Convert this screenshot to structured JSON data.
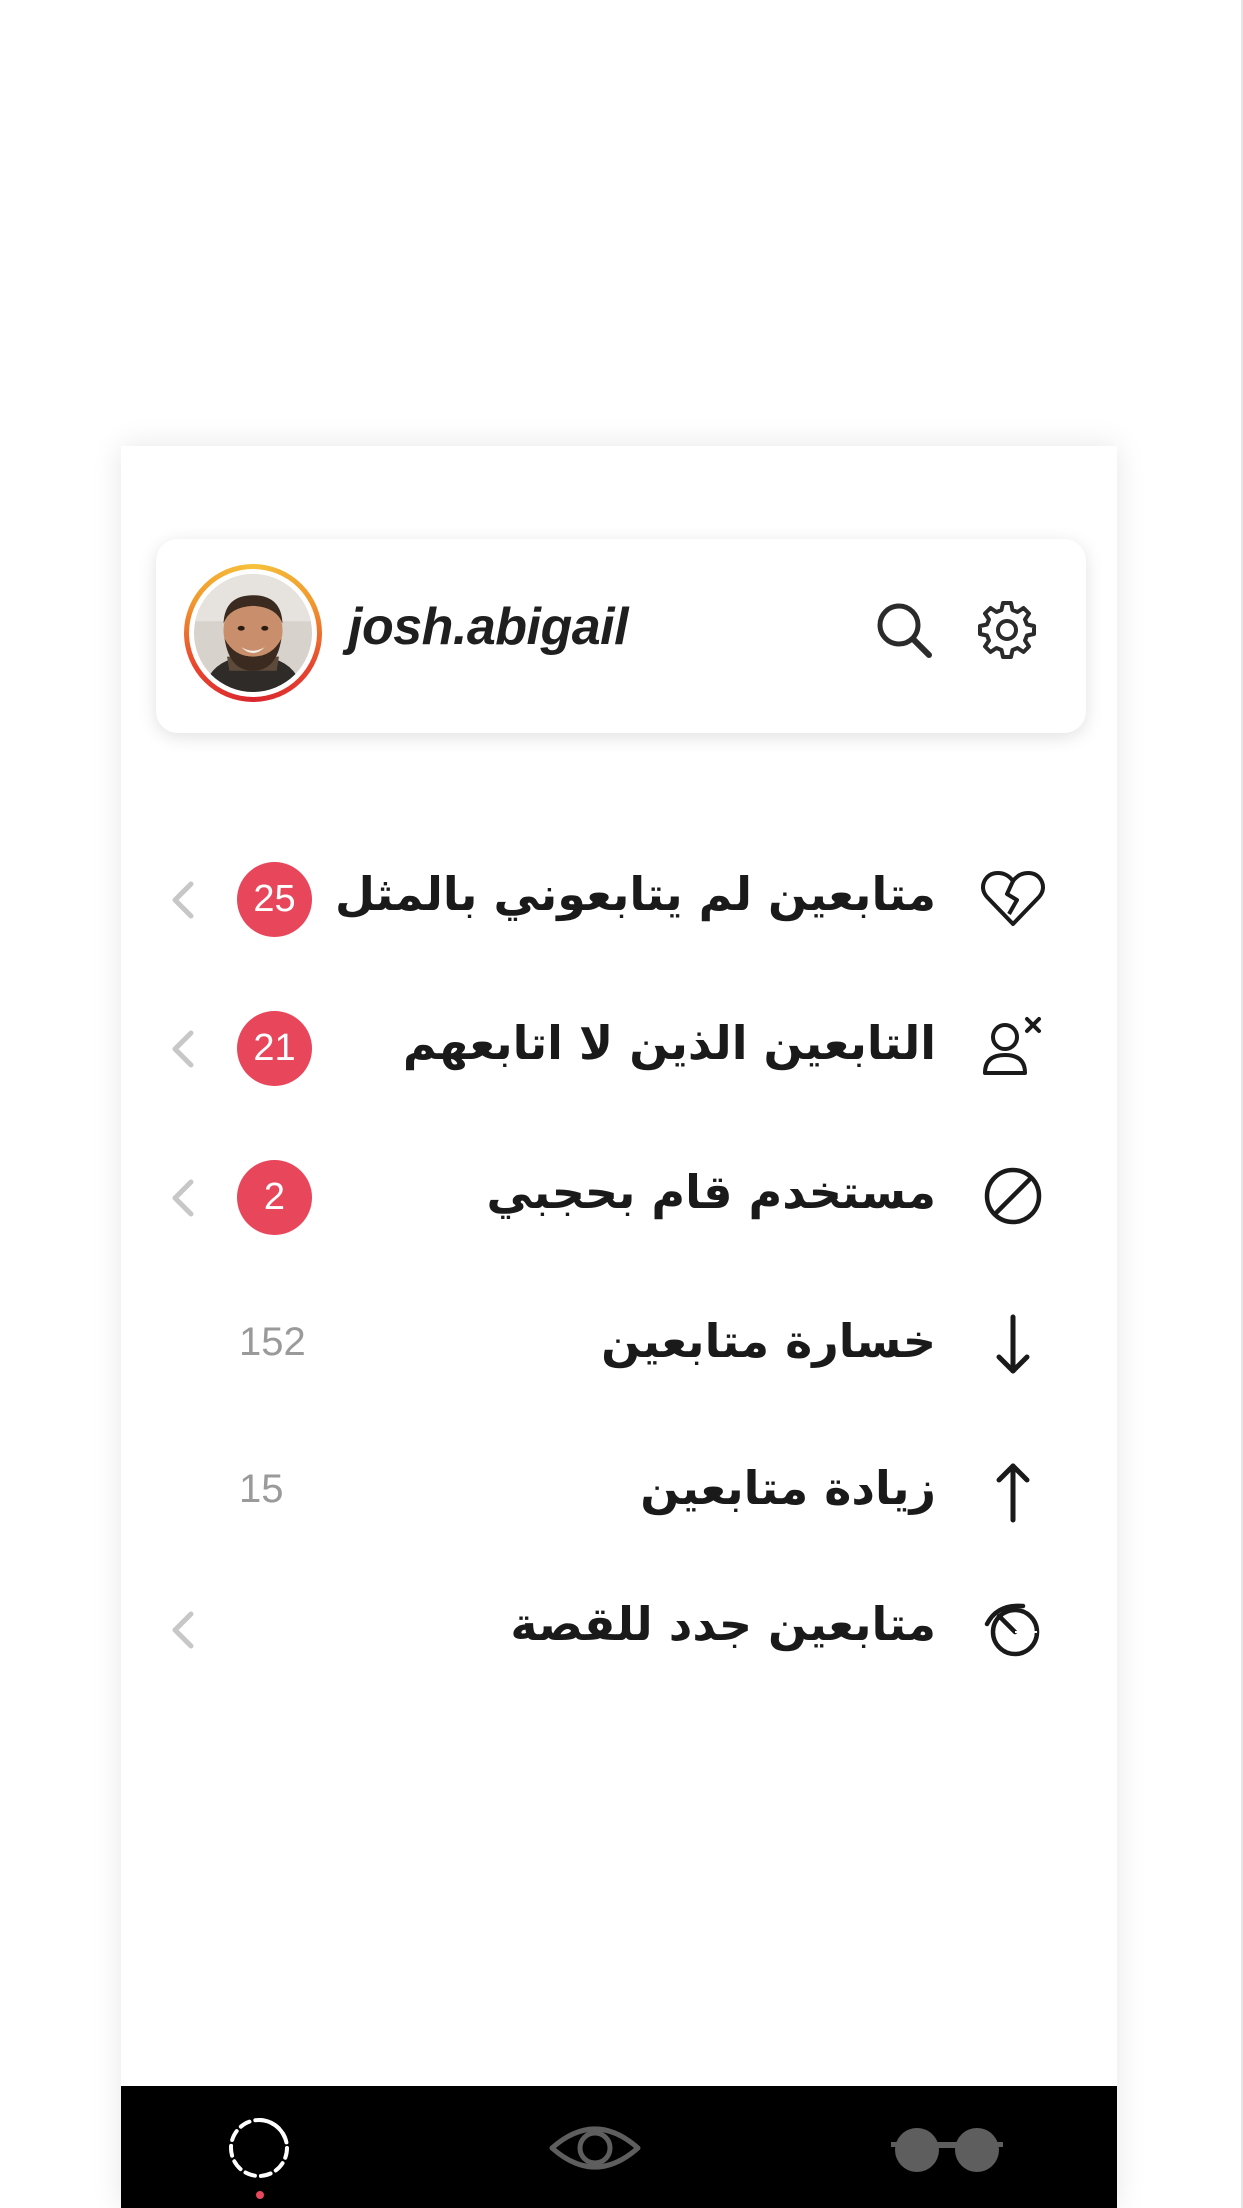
{
  "profile": {
    "username": "josh.abigail"
  },
  "menu": [
    {
      "label": "متابعين لم يتابعوني بالمثل",
      "icon": "broken-heart-icon",
      "badge": "25",
      "has_chevron": true
    },
    {
      "label": "التابعين الذين لا اتابعهم",
      "icon": "user-remove-icon",
      "badge": "21",
      "has_chevron": true
    },
    {
      "label": "مستخدم قام بحجبي",
      "icon": "block-icon",
      "badge": "2",
      "has_chevron": true
    },
    {
      "label": "خسارة متابعين",
      "icon": "arrow-down-icon",
      "count": "152",
      "has_chevron": false
    },
    {
      "label": "زيادة متابعين",
      "icon": "arrow-up-icon",
      "count": "15",
      "has_chevron": false
    },
    {
      "label": "متابعين جدد للقصة",
      "icon": "story-viewers-icon",
      "has_chevron": true
    }
  ],
  "tabbar": {
    "tabs": [
      "home-tab-icon",
      "eye-icon",
      "glasses-icon"
    ],
    "active": "home-tab-icon"
  },
  "colors": {
    "badge": "#e8475b",
    "tabbar": "#000000",
    "count_text": "#9a9a9a",
    "chevron": "#c7c7c7"
  }
}
